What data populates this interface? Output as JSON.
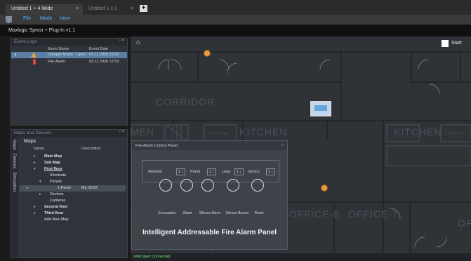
{
  "tabs": [
    {
      "label": "Untitled 1 + 4 Wide",
      "close": "×"
    },
    {
      "label": "Untitled 1 x 1",
      "close": "×"
    }
  ],
  "menu": {
    "file": "File",
    "mode": "Mode",
    "view": "View"
  },
  "app_title": "Maxlogic Sprvsr + Plug-In v1.1",
  "event_logs": {
    "title": "Event Logs",
    "controls": "▫ ×",
    "columns": {
      "name": "Event Name",
      "date": "Event Date"
    },
    "rows": [
      {
        "name": "Damper Active - Open",
        "date": "03.11.2020 12:55",
        "selected": true
      },
      {
        "name": "Fire Alarm",
        "date": "03.11.2020 12:53",
        "selected": false
      }
    ]
  },
  "maps": {
    "title": "Maps and Devices",
    "controls": "▫ ×",
    "side_tabs": [
      "Maps",
      "Devices",
      "Simulation"
    ],
    "section": "Maps",
    "columns": {
      "name": "Name",
      "description": "Description"
    },
    "items": [
      {
        "label": "Main Map",
        "desc": ""
      },
      {
        "label": "Sub Map",
        "desc": ""
      },
      {
        "label": "First floor",
        "desc": ""
      },
      {
        "label": "Shortcuts",
        "desc": ""
      },
      {
        "label": "Panels",
        "desc": ""
      },
      {
        "label": "2.Panel",
        "desc": "ML-12XX"
      },
      {
        "label": "Devices",
        "desc": ""
      },
      {
        "label": "Cameras",
        "desc": ""
      },
      {
        "label": "Second floor",
        "desc": ""
      },
      {
        "label": "Third floor",
        "desc": ""
      },
      {
        "label": "Add New Map",
        "desc": ""
      }
    ]
  },
  "floorplan": {
    "corridor": "CORRIDOR",
    "kitchen": "KITCHEN",
    "kitchen2": "KITCHEN",
    "office8": "OFFICE-8",
    "office7": "OFFICE-7",
    "men": "MEN",
    "of": "OF",
    "asmsoe1": "ASMSOE",
    "asmsoe2": "ASMSOE"
  },
  "start_button": "Start",
  "fire_panel": {
    "title": "Fire Alarm Control Panel",
    "close": "×",
    "selectors": [
      "Network",
      "Panel",
      "Loop",
      "Device"
    ],
    "stepper_text": "1 ↕",
    "buttons": [
      "Evacuation",
      "Alarm",
      "Silence Alarm",
      "Silence Buzzer",
      "Reset"
    ],
    "footer_title": "Intelligent Addressable Fire Alarm Panel"
  },
  "status": "WebSpert Connected"
}
